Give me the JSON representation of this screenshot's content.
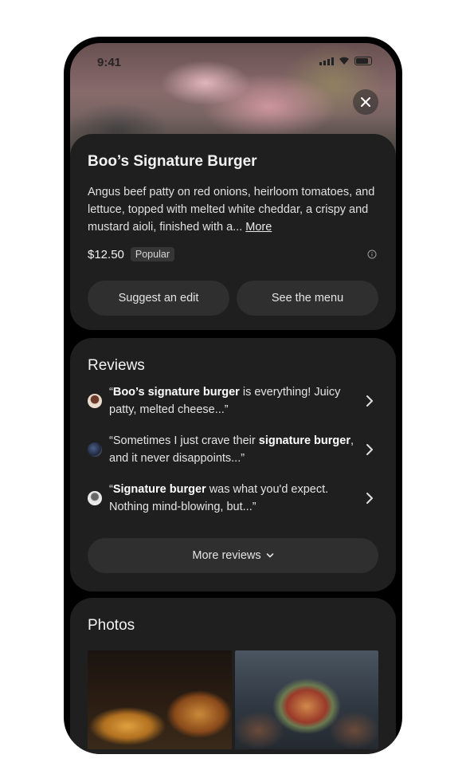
{
  "status_bar": {
    "time": "9:41"
  },
  "item": {
    "title": "Boo’s  Signature Burger",
    "description": "Angus beef patty on red onions, heirloom tomatoes, and lettuce, topped with melted white cheddar, a crispy and mustard aioli, finished with a...",
    "more_label": "More",
    "price": "$12.50",
    "badge": "Popular",
    "suggest_edit_label": "Suggest an edit",
    "see_menu_label": "See the menu"
  },
  "reviews": {
    "title": "Reviews",
    "items": [
      {
        "pre": "“",
        "bold": "Boo’s signature burger",
        "post": " is everything! Juicy patty, melted cheese...”"
      },
      {
        "pre": "“Sometimes I just crave their ",
        "bold": "signature burger",
        "post": ", and it never disappoints...”"
      },
      {
        "pre": "“",
        "bold": "Signature burger",
        "post": " was what you'd expect. Nothing mind-blowing, but...”"
      }
    ],
    "more_label": "More reviews"
  },
  "photos": {
    "title": "Photos"
  },
  "colors": {
    "card_bg": "#1f1f1f",
    "button_bg": "#2f2f2f",
    "screen_bg": "#000000"
  }
}
